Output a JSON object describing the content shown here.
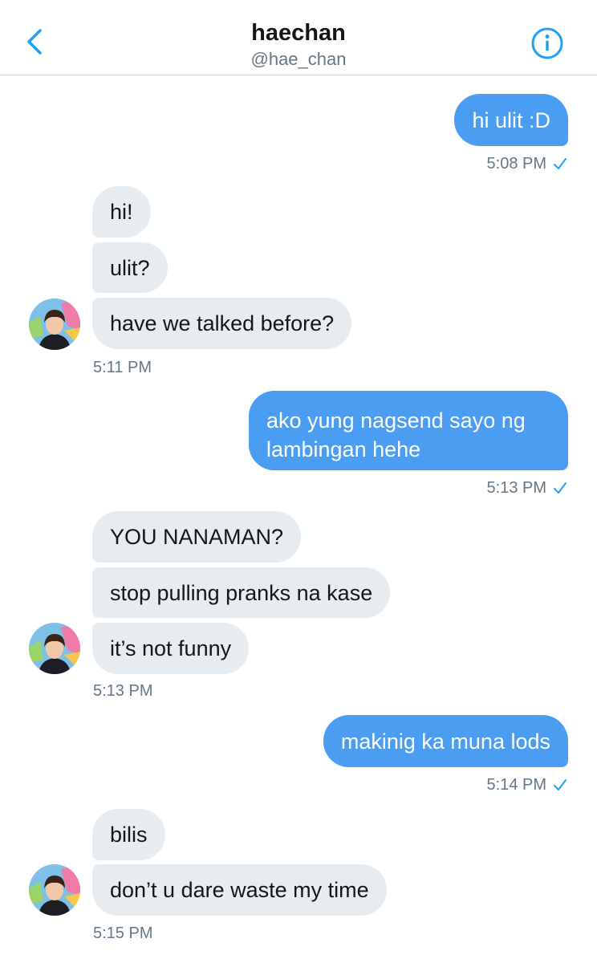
{
  "header": {
    "title": "haechan",
    "handle": "@hae_chan"
  },
  "colors": {
    "accent": "#1da1f2",
    "outgoing_bubble": "#4a9df0",
    "incoming_bubble": "#e6ecf0",
    "timestamp": "#657786"
  },
  "icons": {
    "back": "chevron-left-icon",
    "info": "info-circle-icon",
    "read": "checkmark-icon"
  },
  "messages": {
    "m1": {
      "text": "hi ulit :D",
      "time": "5:08 PM"
    },
    "g1": {
      "lines": [
        "hi!",
        "ulit?",
        "have we talked before?"
      ],
      "time": "5:11 PM"
    },
    "m2": {
      "text": "ako yung nagsend sayo ng lambingan hehe",
      "time": "5:13 PM"
    },
    "g2": {
      "lines": [
        "YOU NANAMAN?",
        "stop pulling pranks na kase",
        "it’s not funny"
      ],
      "time": "5:13 PM"
    },
    "m3": {
      "text": "makinig ka muna lods",
      "time": "5:14 PM"
    },
    "g3": {
      "lines": [
        "bilis",
        "don’t u dare waste my time"
      ],
      "time": "5:15 PM"
    }
  }
}
